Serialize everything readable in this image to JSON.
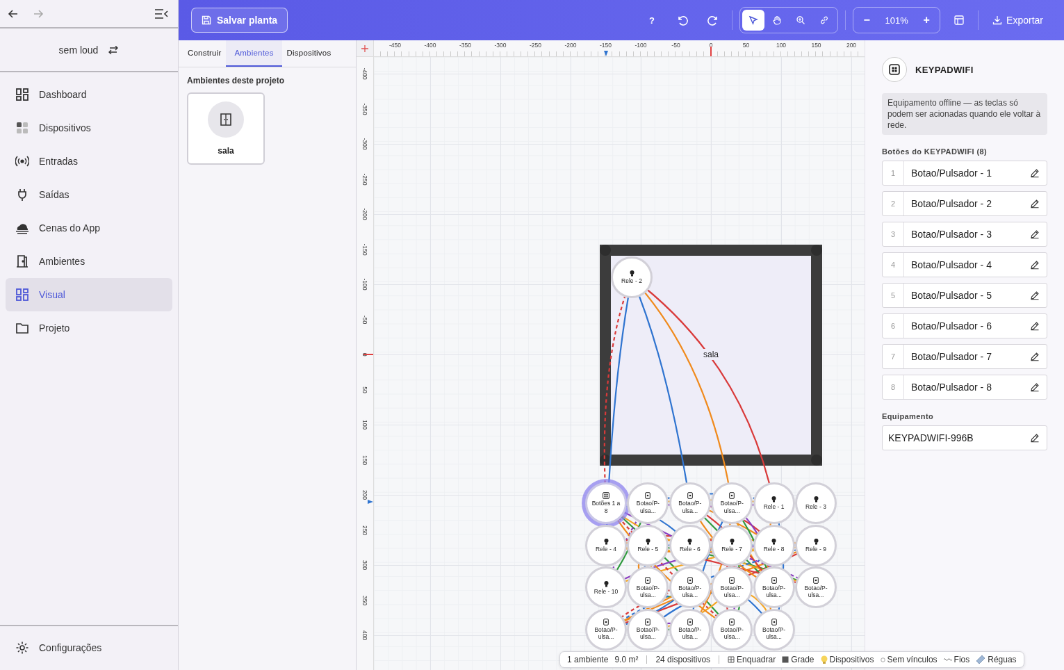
{
  "sidebar": {
    "back": {
      "disabled": false
    },
    "forward": {
      "disabled": true
    },
    "account": {
      "name": "sem loud"
    },
    "items": [
      {
        "label": "Dashboard",
        "kind": "dashboard",
        "selected": false
      },
      {
        "label": "Dispositivos",
        "kind": "devices",
        "selected": false
      },
      {
        "label": "Entradas",
        "kind": "inputs",
        "selected": false
      },
      {
        "label": "Saídas",
        "kind": "outputs",
        "selected": false
      },
      {
        "label": "Cenas do App",
        "kind": "scenes",
        "selected": false
      },
      {
        "label": "Ambientes",
        "kind": "rooms",
        "selected": false
      },
      {
        "label": "Visual",
        "kind": "visual",
        "selected": true
      },
      {
        "label": "Projeto",
        "kind": "project",
        "selected": false
      }
    ],
    "footer_item": {
      "label": "Configurações",
      "kind": "settings"
    }
  },
  "toolbar": {
    "save_label": "Salvar planta",
    "help": "?",
    "tools": [
      {
        "kind": "select",
        "selected": true
      },
      {
        "kind": "pan",
        "selected": false
      },
      {
        "kind": "zoom",
        "selected": false
      },
      {
        "kind": "link",
        "selected": false
      }
    ],
    "zoom_out": "−",
    "zoom": "101%",
    "zoom_in": "+",
    "export_label": "Exportar"
  },
  "left_panel": {
    "tabs": [
      {
        "label": "Construir",
        "selected": false
      },
      {
        "label": "Ambientes",
        "selected": true
      },
      {
        "label": "Dispositivos",
        "selected": false
      }
    ],
    "section_title": "Ambientes deste projeto",
    "rooms": [
      {
        "name": "sala"
      }
    ]
  },
  "canvas": {
    "h_ruler": [
      "-450",
      "-400",
      "-350",
      "-300",
      "-250",
      "-200",
      "-150",
      "-100",
      "-50",
      "0",
      "50",
      "100",
      "150",
      "200"
    ],
    "v_ruler": [
      "-400",
      "-350",
      "-300",
      "-250",
      "-200",
      "-150",
      "-100",
      "-50",
      "0",
      "50",
      "100",
      "150",
      "200",
      "250",
      "300",
      "350",
      "400"
    ],
    "room": {
      "name": "sala"
    },
    "devices": [
      {
        "label": "Rele - 2",
        "kind": "relay",
        "in_room": true,
        "selected": false
      },
      {
        "label": "Botões 1 a 8",
        "kind": "keypad",
        "in_room": false,
        "selected": true
      },
      {
        "label": "Botao/P-ulsa...",
        "kind": "button",
        "in_room": false,
        "selected": false
      },
      {
        "label": "Botao/P-ulsa...",
        "kind": "button",
        "in_room": false,
        "selected": false
      },
      {
        "label": "Botao/P-ulsa...",
        "kind": "button",
        "in_room": false,
        "selected": false
      },
      {
        "label": "Rele - 1",
        "kind": "relay",
        "in_room": false,
        "selected": false
      },
      {
        "label": "Rele - 3",
        "kind": "relay",
        "in_room": false,
        "selected": false
      },
      {
        "label": "Rele - 4",
        "kind": "relay",
        "in_room": false,
        "selected": false
      },
      {
        "label": "Rele - 5",
        "kind": "relay",
        "in_room": false,
        "selected": false
      },
      {
        "label": "Rele - 6",
        "kind": "relay",
        "in_room": false,
        "selected": false
      },
      {
        "label": "Rele - 7",
        "kind": "relay",
        "in_room": false,
        "selected": false
      },
      {
        "label": "Rele - 8",
        "kind": "relay",
        "in_room": false,
        "selected": false
      },
      {
        "label": "Rele - 9",
        "kind": "relay",
        "in_room": false,
        "selected": false
      },
      {
        "label": "Rele - 10",
        "kind": "relay",
        "in_room": false,
        "selected": false
      },
      {
        "label": "Botao/P-ulsa...",
        "kind": "button",
        "in_room": false,
        "selected": false
      },
      {
        "label": "Botao/P-ulsa...",
        "kind": "button",
        "in_room": false,
        "selected": false
      },
      {
        "label": "Botao/P-ulsa...",
        "kind": "button",
        "in_room": false,
        "selected": false
      },
      {
        "label": "Botao/P-ulsa...",
        "kind": "button",
        "in_room": false,
        "selected": false
      },
      {
        "label": "Botao/P-ulsa...",
        "kind": "button",
        "in_room": false,
        "selected": false
      },
      {
        "label": "Botao/P-ulsa...",
        "kind": "button",
        "in_room": false,
        "selected": false
      },
      {
        "label": "Botao/P-ulsa...",
        "kind": "button",
        "in_room": false,
        "selected": false
      },
      {
        "label": "Botao/P-ulsa...",
        "kind": "button",
        "in_room": false,
        "selected": false
      },
      {
        "label": "Botao/P-ulsa...",
        "kind": "button",
        "in_room": false,
        "selected": false
      },
      {
        "label": "Botao/P-ulsa...",
        "kind": "button",
        "in_room": false,
        "selected": false
      }
    ]
  },
  "status_bar": {
    "stats": [
      "1 ambiente",
      "9.0 m²"
    ],
    "count": "24 dispositivos",
    "toggles": [
      {
        "label": "Enquadrar",
        "kind": "frame"
      },
      {
        "label": "Grade",
        "kind": "grid"
      },
      {
        "label": "Dispositivos",
        "kind": "devices"
      },
      {
        "label": "Sem vínculos",
        "kind": "unlinked"
      },
      {
        "label": "Fios",
        "kind": "wires"
      },
      {
        "label": "Réguas",
        "kind": "rulers"
      }
    ]
  },
  "inspector": {
    "title": "KEYPADWIFI",
    "notice": "Equipamento offline — as teclas só podem ser acionadas quando ele voltar à rede.",
    "buttons_title": "Botões do KEYPADWIFI (8)",
    "buttons": [
      {
        "number": "1",
        "label": "Botao/Pulsador - 1"
      },
      {
        "number": "2",
        "label": "Botao/Pulsador - 2"
      },
      {
        "number": "3",
        "label": "Botao/Pulsador - 3"
      },
      {
        "number": "4",
        "label": "Botao/Pulsador - 4"
      },
      {
        "number": "5",
        "label": "Botao/Pulsador - 5"
      },
      {
        "number": "6",
        "label": "Botao/Pulsador - 6"
      },
      {
        "number": "7",
        "label": "Botao/Pulsador - 7"
      },
      {
        "number": "8",
        "label": "Botao/Pulsador - 8"
      }
    ],
    "equipment_label": "Equipamento",
    "equipment_value": "KEYPADWIFI-996B"
  }
}
